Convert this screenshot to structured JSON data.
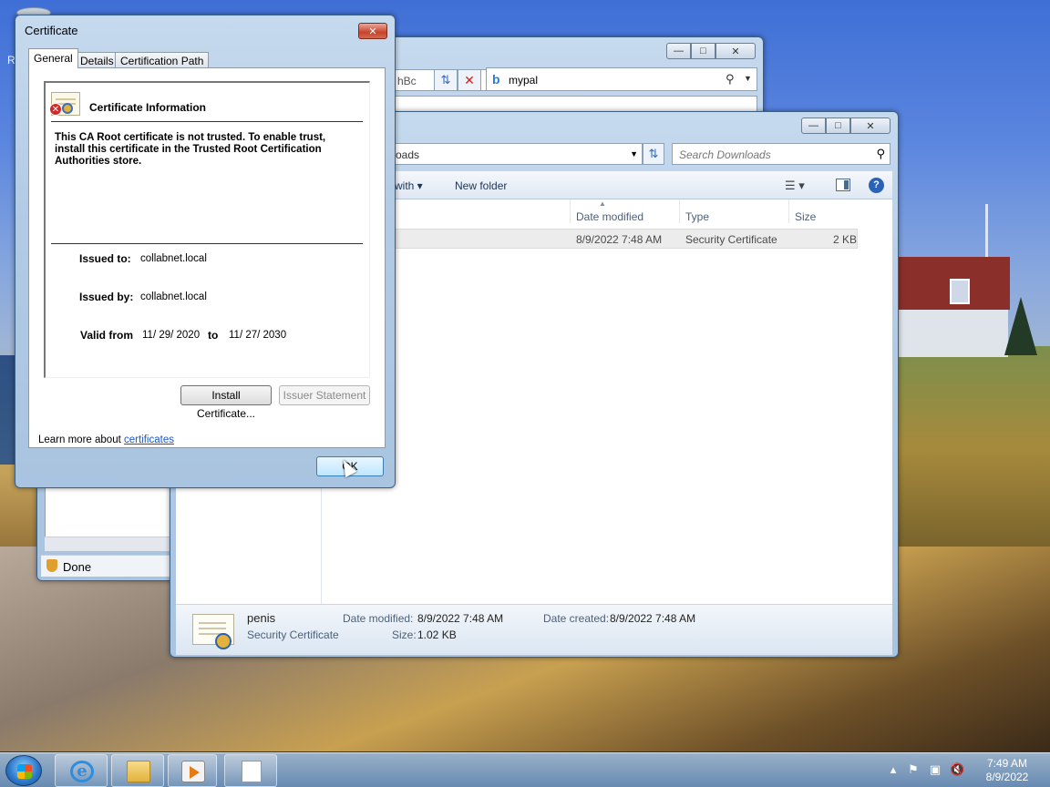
{
  "desktop": {
    "partial_letter": "R"
  },
  "ie": {
    "address_partial": "hBc",
    "search_engine_glyph": "b",
    "search_text": "mypal",
    "status_text": "Done"
  },
  "explorer": {
    "address_partial": "oads",
    "search_placeholder": "Search Downloads",
    "toolbar": {
      "open_with": "with",
      "new_folder": "New folder"
    },
    "columns": {
      "date_modified": "Date modified",
      "type": "Type",
      "size": "Size"
    },
    "file": {
      "date_modified": "8/9/2022 7:48 AM",
      "type": "Security Certificate",
      "size": "2 KB"
    },
    "details": {
      "name": "penis",
      "type": "Security Certificate",
      "date_modified_label": "Date modified:",
      "date_modified": "8/9/2022 7:48 AM",
      "date_created_label": "Date created:",
      "date_created": "8/9/2022 7:48 AM",
      "size_label": "Size:",
      "size": "1.02 KB"
    }
  },
  "certificate": {
    "title": "Certificate",
    "tabs": [
      "General",
      "Details",
      "Certification Path"
    ],
    "info_title": "Certificate Information",
    "warning": "This CA Root certificate is not trusted. To enable trust, install this certificate in the Trusted Root Certification Authorities store.",
    "issued_to_label": "Issued to:",
    "issued_to": "collabnet.local",
    "issued_by_label": "Issued by:",
    "issued_by": "collabnet.local",
    "valid_from_label": "Valid from",
    "valid_from": "11/ 29/ 2020",
    "to_label": "to",
    "valid_to": "11/ 27/ 2030",
    "install_button": "Install Certificate...",
    "issuer_button": "Issuer Statement",
    "learn_more": "Learn more about",
    "learn_link": "certificates",
    "ok_button": "OK"
  },
  "taskbar": {
    "time": "7:49 AM",
    "date": "8/9/2022"
  }
}
